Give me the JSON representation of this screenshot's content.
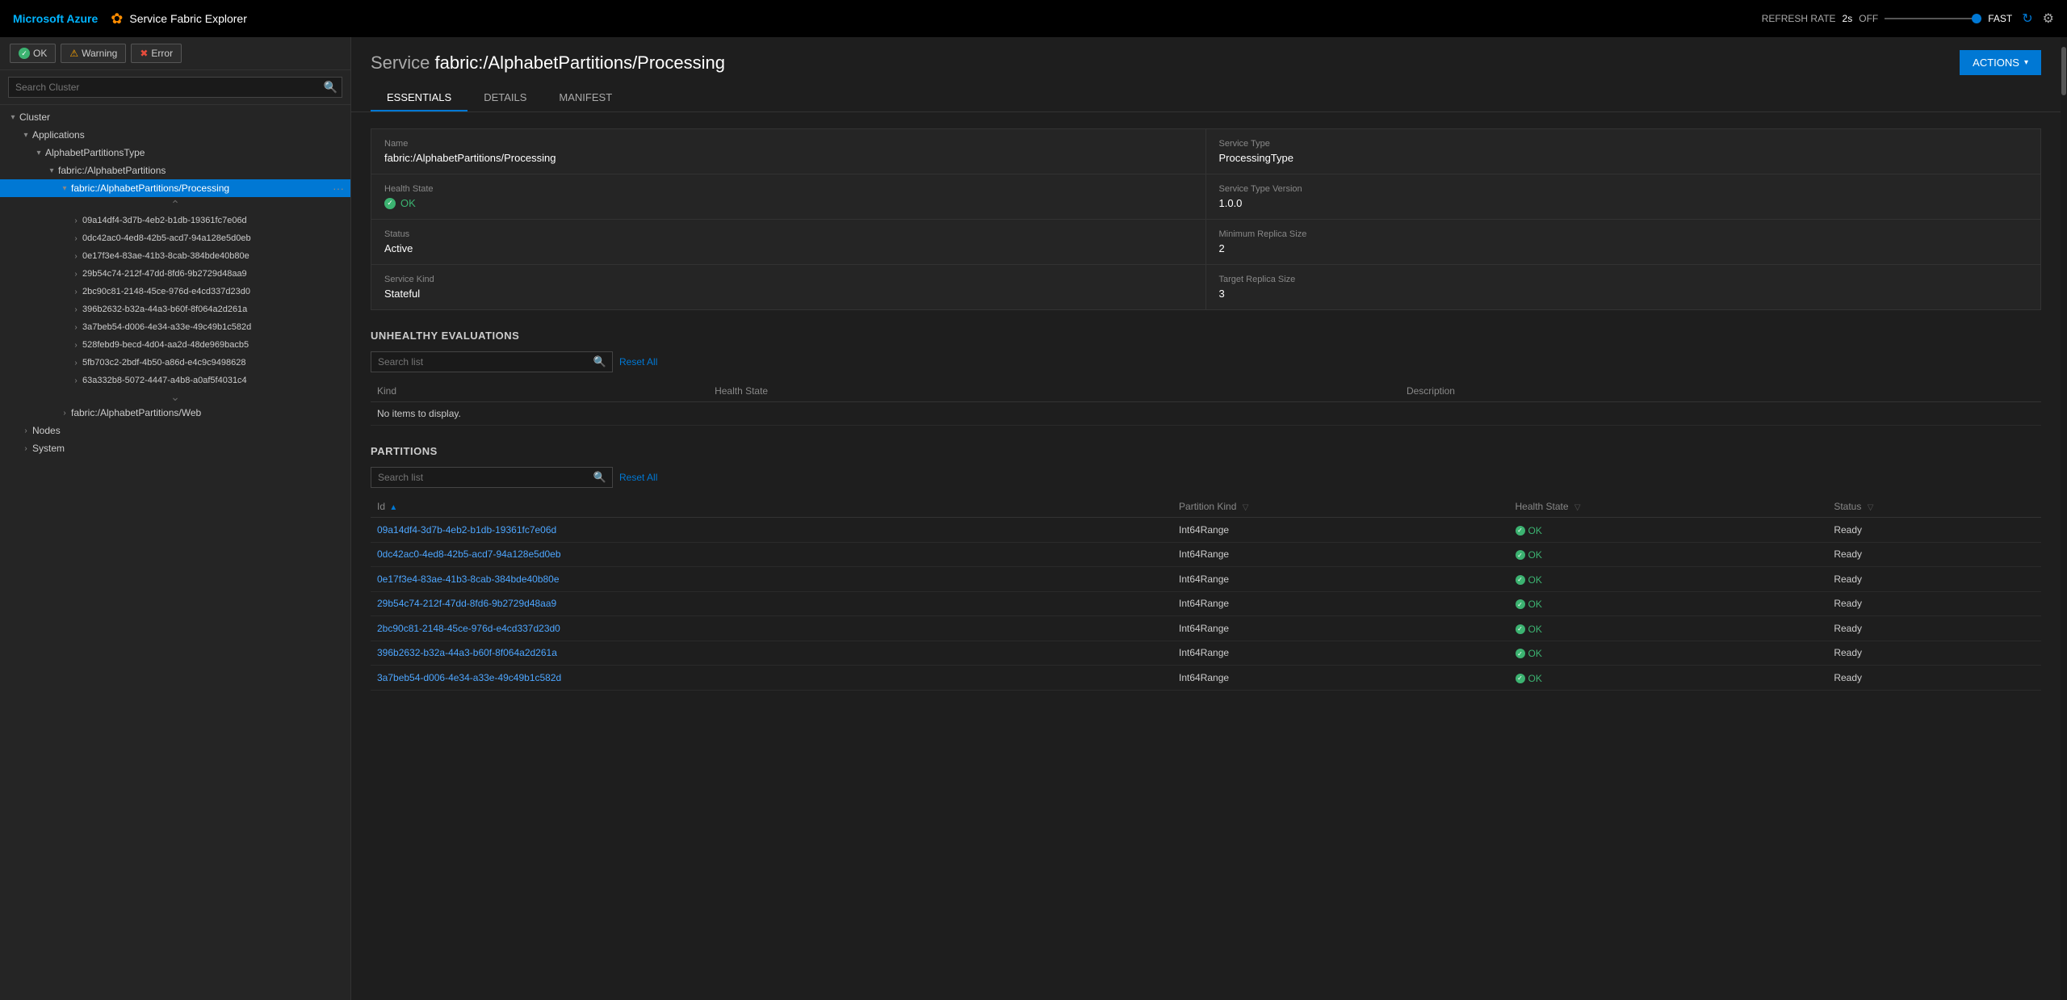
{
  "topbar": {
    "azure_label": "Microsoft Azure",
    "app_title": "Service Fabric Explorer",
    "refresh_rate_label": "REFRESH RATE",
    "refresh_value": "2s",
    "off_label": "OFF",
    "fast_label": "FAST"
  },
  "sidebar": {
    "search_placeholder": "Search Cluster",
    "filter_ok": "OK",
    "filter_warning": "Warning",
    "filter_error": "Error",
    "tree": {
      "cluster_label": "Cluster",
      "applications_label": "Applications",
      "alphabet_partitions_type_label": "AlphabetPartitionsType",
      "fabric_alphabet_partitions_label": "fabric:/AlphabetPartitions",
      "processing_label": "fabric:/AlphabetPartitions/Processing",
      "web_label": "fabric:/AlphabetPartitions/Web",
      "nodes_label": "Nodes",
      "system_label": "System",
      "partitions": [
        "09a14df4-3d7b-4eb2-b1db-19361fc7e06d",
        "0dc42ac0-4ed8-42b5-acd7-94a128e5d0eb",
        "0e17f3e4-83ae-41b3-8cab-384bde40b80e",
        "29b54c74-212f-47dd-8fd6-9b2729d48aa9",
        "2bc90c81-2148-45ce-976d-e4cd337d23d0",
        "396b2632-b32a-44a3-b60f-8f064a2d261a",
        "3a7beb54-d006-4e34-a33e-49c49b1c582d",
        "528febd9-becd-4d04-aa2d-48de969bacb5",
        "5fb703c2-2bdf-4b50-a86d-e4c9c9498628",
        "63a332b8-5072-4447-a4b8-a0af5f4031c4"
      ]
    }
  },
  "content": {
    "service_label": "Service",
    "service_name": "fabric:/AlphabetPartitions/Processing",
    "actions_label": "ACTIONS",
    "tabs": [
      "ESSENTIALS",
      "DETAILS",
      "MANIFEST"
    ],
    "active_tab": "ESSENTIALS",
    "essentials": {
      "name_label": "Name",
      "name_value": "fabric:/AlphabetPartitions/Processing",
      "health_state_label": "Health State",
      "health_state_value": "OK",
      "status_label": "Status",
      "status_value": "Active",
      "service_kind_label": "Service Kind",
      "service_kind_value": "Stateful",
      "service_type_label": "Service Type",
      "service_type_value": "ProcessingType",
      "service_type_version_label": "Service Type Version",
      "service_type_version_value": "1.0.0",
      "min_replica_label": "Minimum Replica Size",
      "min_replica_value": "2",
      "target_replica_label": "Target Replica Size",
      "target_replica_value": "3"
    },
    "unhealthy_section": {
      "title": "UNHEALTHY EVALUATIONS",
      "search_placeholder": "Search list",
      "reset_label": "Reset All",
      "columns": [
        "Kind",
        "Health State",
        "Description"
      ],
      "no_items": "No items to display."
    },
    "partitions_section": {
      "title": "PARTITIONS",
      "search_placeholder": "Search list",
      "reset_label": "Reset All",
      "columns": {
        "id": "Id",
        "partition_kind": "Partition Kind",
        "health_state": "Health State",
        "status": "Status"
      },
      "rows": [
        {
          "id": "09a14df4-3d7b-4eb2-b1db-19361fc7e06d",
          "partition_kind": "Int64Range",
          "health_state": "OK",
          "status": "Ready"
        },
        {
          "id": "0dc42ac0-4ed8-42b5-acd7-94a128e5d0eb",
          "partition_kind": "Int64Range",
          "health_state": "OK",
          "status": "Ready"
        },
        {
          "id": "0e17f3e4-83ae-41b3-8cab-384bde40b80e",
          "partition_kind": "Int64Range",
          "health_state": "OK",
          "status": "Ready"
        },
        {
          "id": "29b54c74-212f-47dd-8fd6-9b2729d48aa9",
          "partition_kind": "Int64Range",
          "health_state": "OK",
          "status": "Ready"
        },
        {
          "id": "2bc90c81-2148-45ce-976d-e4cd337d23d0",
          "partition_kind": "Int64Range",
          "health_state": "OK",
          "status": "Ready"
        },
        {
          "id": "396b2632-b32a-44a3-b60f-8f064a2d261a",
          "partition_kind": "Int64Range",
          "health_state": "OK",
          "status": "Ready"
        },
        {
          "id": "3a7beb54-d006-4e34-a33e-49c49b1c582d",
          "partition_kind": "Int64Range",
          "health_state": "OK",
          "status": "Ready"
        }
      ]
    }
  }
}
